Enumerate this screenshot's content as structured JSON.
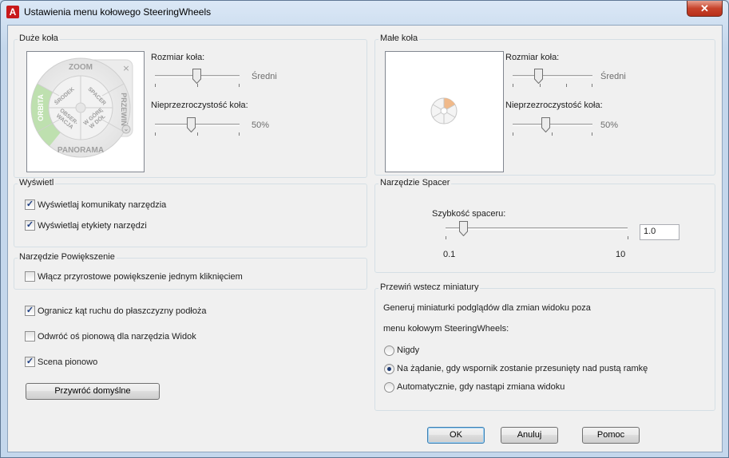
{
  "window": {
    "title": "Ustawienia menu kołowego SteeringWheels",
    "close_glyph": "✕",
    "app_icon_letter": "A"
  },
  "big_wheels": {
    "group_title": "Duże koła",
    "wheel_labels": {
      "zoom": "ZOOM",
      "orbit": "ORBITA",
      "rewind": "PRZEWIŃ",
      "panorama": "PANORAMA",
      "center": "ŚRODEK",
      "walk": "SPACER",
      "look_1": "OBSER-",
      "look_2": "WACJA",
      "updown_1": "W GÓRĘ",
      "updown_2": "W DÓŁ",
      "close_glyph": "×",
      "menu_glyph": "⌄"
    },
    "size_label": "Rozmiar koła:",
    "size_value": "Średni",
    "size_level": 0.5,
    "opacity_label": "Nieprzezroczystość koła:",
    "opacity_value": "50%",
    "opacity_level": 0.4
  },
  "mini_wheels": {
    "group_title": "Małe koła",
    "size_label": "Rozmiar koła:",
    "size_value": "Średni",
    "size_level": 0.33,
    "opacity_label": "Nieprzezroczystość koła:",
    "opacity_value": "50%",
    "opacity_level": 0.4
  },
  "display": {
    "group_title": "Wyświetl",
    "show_messages": {
      "label": "Wyświetlaj komunikaty narzędzia",
      "checked": true
    },
    "show_labels": {
      "label": "Wyświetlaj etykiety narzędzi",
      "checked": true
    }
  },
  "zoom_tool": {
    "group_title": "Narzędzie Powiększenie",
    "incremental": {
      "label": "Włącz przyrostowe powiększenie jednym kliknięciem",
      "checked": false
    }
  },
  "options": {
    "constrain_orbit": {
      "label": "Ogranicz kąt ruchu do płaszczyzny podłoża",
      "checked": true
    },
    "invert_vertical": {
      "label": "Odwróć oś pionową dla narzędzia Widok",
      "checked": false
    },
    "keep_upright": {
      "label": "Scena pionowo",
      "checked": true
    },
    "restore_defaults_label": "Przywróć domyślne"
  },
  "walk_tool": {
    "group_title": "Narzędzie Spacer",
    "speed_label": "Szybkość spaceru:",
    "speed_min": "0.1",
    "speed_max": "10",
    "speed_value": "1.0",
    "speed_level": 0.1
  },
  "rewind_thumbs": {
    "group_title": "Przewiń wstecz miniatury",
    "description_1": "Generuj miniaturki podglądów dla zmian widoku poza",
    "description_2": "menu kołowym SteeringWheels:",
    "options": [
      {
        "label": "Nigdy",
        "selected": false
      },
      {
        "label": "Na żądanie, gdy wspornik zostanie przesunięty nad pustą ramkę",
        "selected": true
      },
      {
        "label": "Automatycznie, gdy nastąpi zmiana widoku",
        "selected": false
      }
    ]
  },
  "buttons": {
    "ok": "OK",
    "cancel": "Anuluj",
    "help": "Pomoc"
  },
  "colors": {
    "accent_orbit": "#b9dfa8",
    "mini_wheel_highlight": "#f0b98a",
    "close_red": "#c7432b"
  }
}
